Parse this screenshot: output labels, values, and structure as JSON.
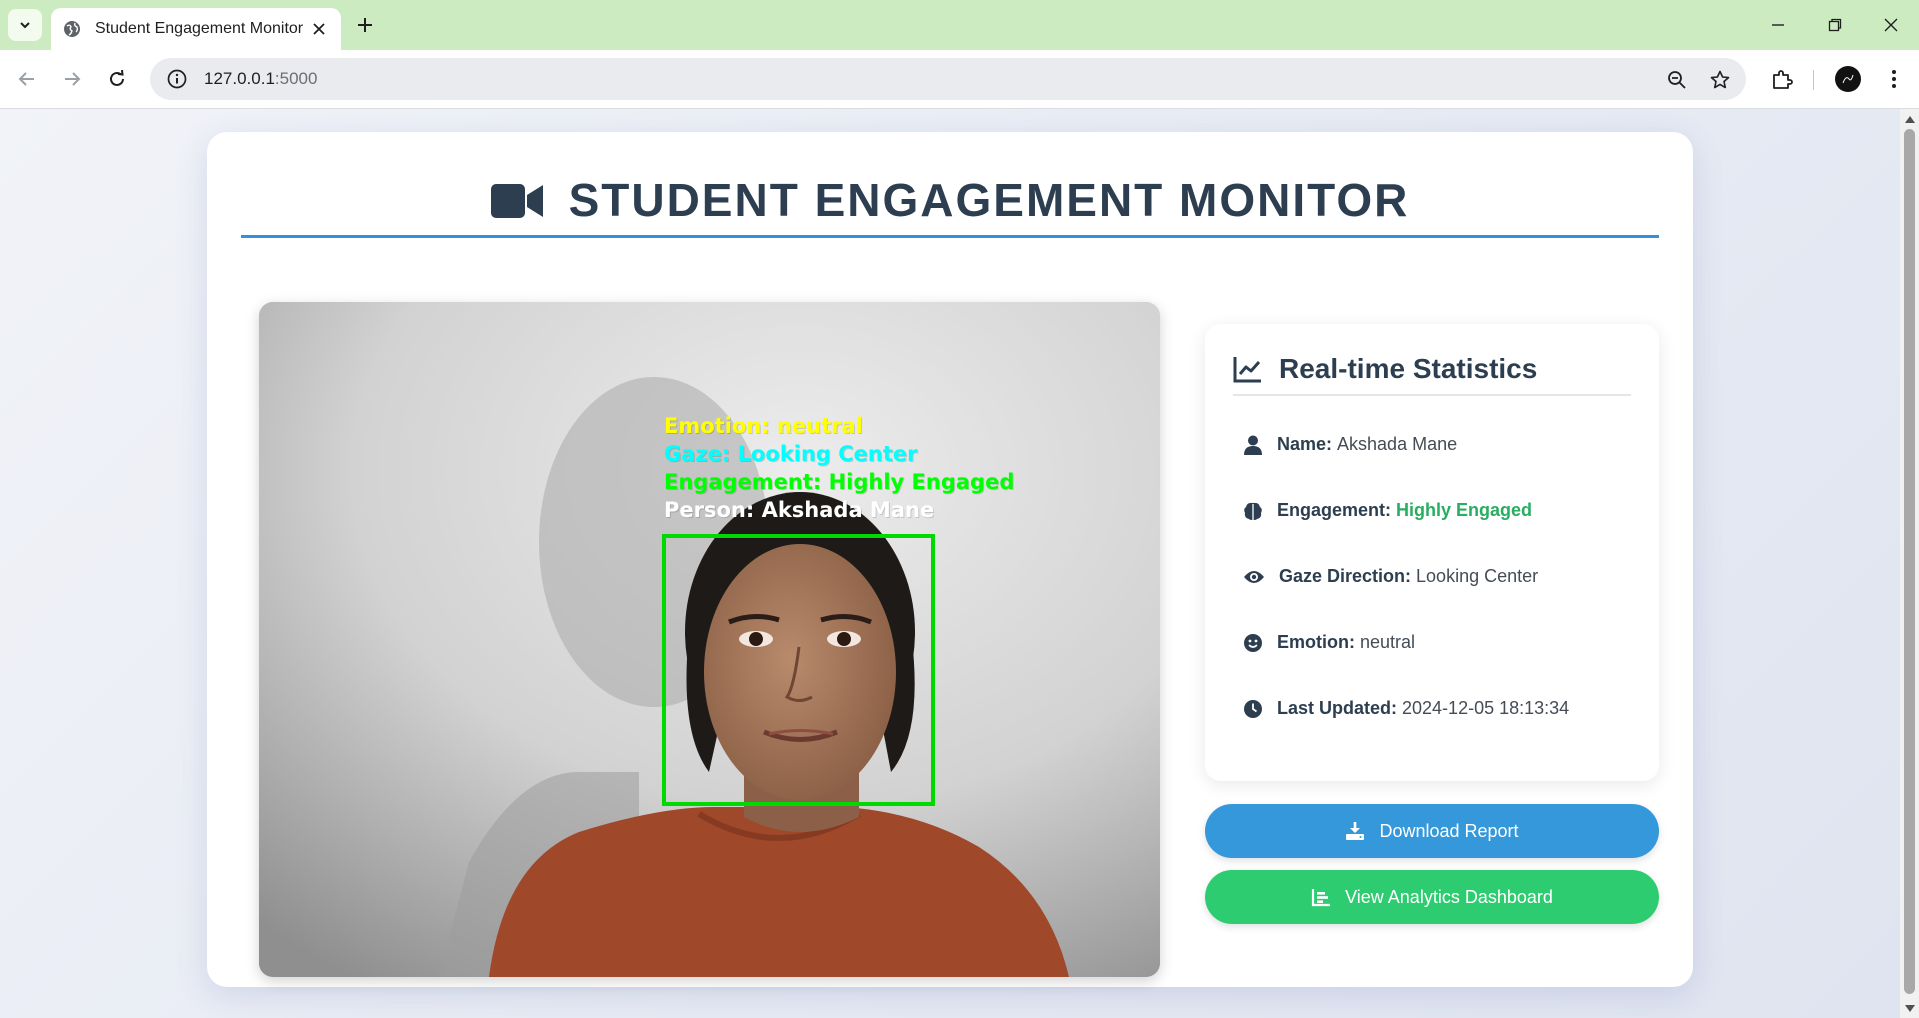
{
  "browser": {
    "tab_title": "Student Engagement Monitor",
    "url_host": "127.0.0.1",
    "url_port": ":5000"
  },
  "page": {
    "title": "STUDENT ENGAGEMENT MONITOR"
  },
  "video": {
    "overlay_emotion": "Emotion: neutral",
    "overlay_gaze": "Gaze: Looking Center",
    "overlay_engagement": "Engagement: Highly Engaged",
    "overlay_person": "Person: Akshada Mane",
    "colors": {
      "emotion": "#ffff00",
      "gaze": "#00ffff",
      "engagement": "#00ff00",
      "person": "#ffffff",
      "box": "#00d900"
    }
  },
  "stats": {
    "title": "Real-time Statistics",
    "name_label": "Name:",
    "name_value": "Akshada Mane",
    "engagement_label": "Engagement:",
    "engagement_value": "Highly Engaged",
    "gaze_label": "Gaze Direction:",
    "gaze_value": "Looking Center",
    "emotion_label": "Emotion:",
    "emotion_value": "neutral",
    "updated_label": "Last Updated:",
    "updated_value": "2024-12-05 18:13:34"
  },
  "buttons": {
    "download": "Download Report",
    "analytics": "View Analytics Dashboard"
  },
  "theme": {
    "primary_blue": "#3498db",
    "success_green": "#2ecc71",
    "engaged_green": "#27ae60",
    "heading_dark": "#2c3e50"
  },
  "icons": [
    "video-camera-icon",
    "line-chart-icon",
    "user-icon",
    "brain-icon",
    "eye-icon",
    "smile-icon",
    "clock-icon",
    "download-icon",
    "bar-chart-icon"
  ]
}
